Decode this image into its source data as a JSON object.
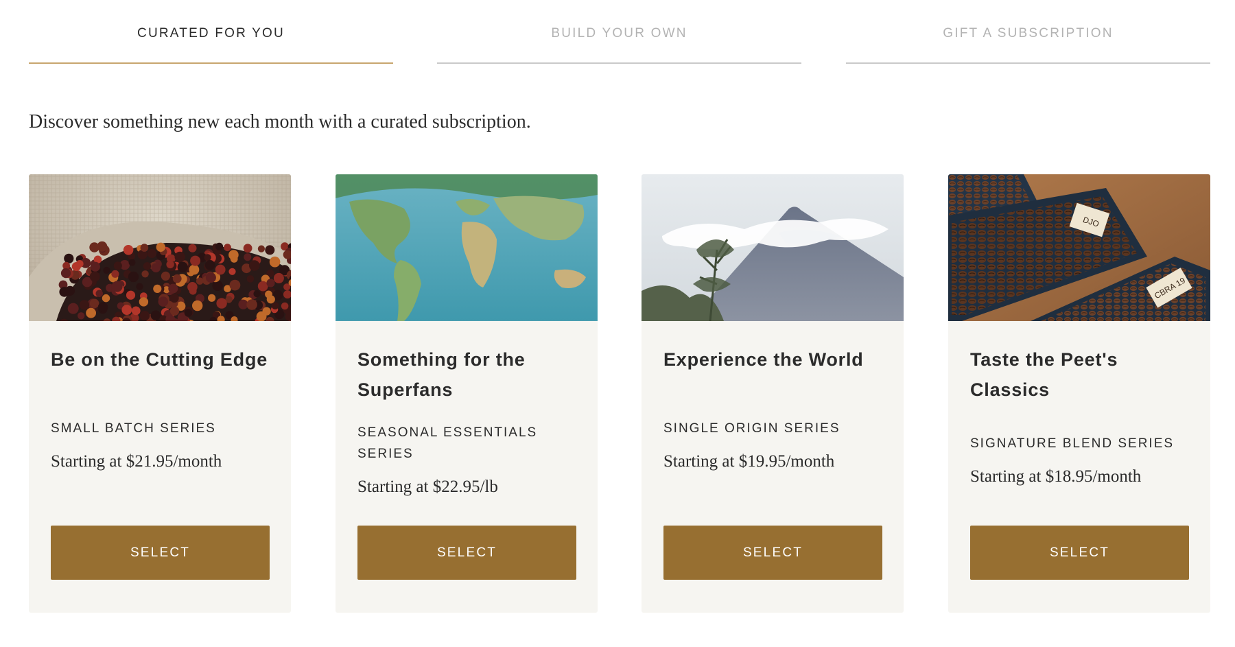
{
  "tabs": [
    {
      "label": "CURATED FOR YOU",
      "active": true
    },
    {
      "label": "BUILD YOUR OWN",
      "active": false
    },
    {
      "label": "GIFT A SUBSCRIPTION",
      "active": false
    }
  ],
  "intro": "Discover something new each month with a curated subscription.",
  "cards": [
    {
      "title": "Be on the Cutting Edge",
      "series": "SMALL BATCH SERIES",
      "price": "Starting at $21.95/month",
      "button": "SELECT",
      "image": "coffee-cherries-burlap-sack"
    },
    {
      "title": "Something for the Superfans",
      "series": "SEASONAL ESSENTIALS SERIES",
      "price": "Starting at $22.95/lb",
      "button": "SELECT",
      "image": "world-map"
    },
    {
      "title": "Experience the World",
      "series": "SINGLE ORIGIN SERIES",
      "price": "Starting at $19.95/month",
      "button": "SELECT",
      "image": "volcano-with-clouds"
    },
    {
      "title": "Taste the Peet's Classics",
      "series": "SIGNATURE BLEND SERIES",
      "price": "Starting at $18.95/month",
      "button": "SELECT",
      "image": "coffee-beans-in-trays"
    }
  ],
  "image_labels": {
    "tray_tag_1": "DJO",
    "tray_tag_2": "CBRA 19"
  },
  "colors": {
    "accent": "#976f31",
    "active_tab_line": "#c7a56e",
    "card_bg": "#f6f5f1",
    "inactive_tab": "#b3b3b3"
  }
}
